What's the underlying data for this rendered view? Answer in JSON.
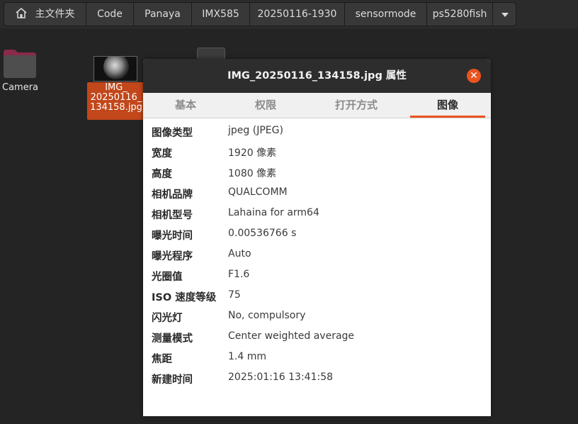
{
  "pathbar": {
    "home_label": "主文件夹",
    "crumbs": [
      "Code",
      "Panaya",
      "IMX585",
      "20250116-1930",
      "sensormode",
      "ps5280fish"
    ]
  },
  "files": {
    "folder_name": "Camera",
    "selected_name_lines": [
      "IMG_",
      "20250116_",
      "134158.jpg"
    ]
  },
  "dialog": {
    "title": "IMG_20250116_134158.jpg 属性",
    "close_symbol": "✕",
    "tabs": [
      "基本",
      "权限",
      "打开方式",
      "图像"
    ],
    "active_tab": "图像",
    "properties": [
      {
        "label": "图像类型",
        "value": "jpeg (JPEG)"
      },
      {
        "label": "宽度",
        "value": "1920 像素"
      },
      {
        "label": "高度",
        "value": "1080 像素"
      },
      {
        "label": "相机品牌",
        "value": "QUALCOMM"
      },
      {
        "label": "相机型号",
        "value": "Lahaina for arm64"
      },
      {
        "label": "曝光时间",
        "value": "0.00536766 s"
      },
      {
        "label": "曝光程序",
        "value": "Auto"
      },
      {
        "label": "光圈值",
        "value": "F1.6"
      },
      {
        "label": "ISO 速度等级",
        "value": "75"
      },
      {
        "label": "闪光灯",
        "value": "No, compulsory"
      },
      {
        "label": "测量模式",
        "value": "Center weighted average"
      },
      {
        "label": "焦距",
        "value": "1.4 mm"
      },
      {
        "label": "新建时间",
        "value": "2025:01:16 13:41:58"
      }
    ]
  },
  "colors": {
    "accent": "#e95420",
    "selection": "#c2471a"
  }
}
